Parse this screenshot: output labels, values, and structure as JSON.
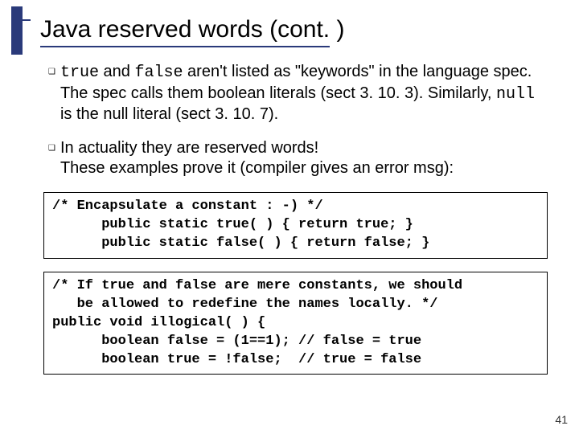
{
  "title": "Java reserved words (cont. )",
  "bullets": [
    {
      "parts": [
        {
          "code": true,
          "text": "true"
        },
        {
          "code": false,
          "text": " and "
        },
        {
          "code": true,
          "text": "false"
        },
        {
          "code": false,
          "text": " aren't listed as \"keywords\" in the language spec. The spec calls them boolean literals (sect 3. 10. 3). Similarly, "
        },
        {
          "code": true,
          "text": "null"
        },
        {
          "code": false,
          "text": " is the null literal (sect 3. 10. 7)."
        }
      ]
    },
    {
      "parts": [
        {
          "code": false,
          "text": "In actuality they are reserved words!\nThese examples prove it (compiler gives an error msg):"
        }
      ]
    }
  ],
  "code_blocks": [
    "/* Encapsulate a constant : -) */\n      public static true( ) { return true; }\n      public static false( ) { return false; }",
    "/* If true and false are mere constants, we should\n   be allowed to redefine the names locally. */\npublic void illogical( ) {\n      boolean false = (1==1); // false = true\n      boolean true = !false;  // true = false"
  ],
  "page_number": "41"
}
